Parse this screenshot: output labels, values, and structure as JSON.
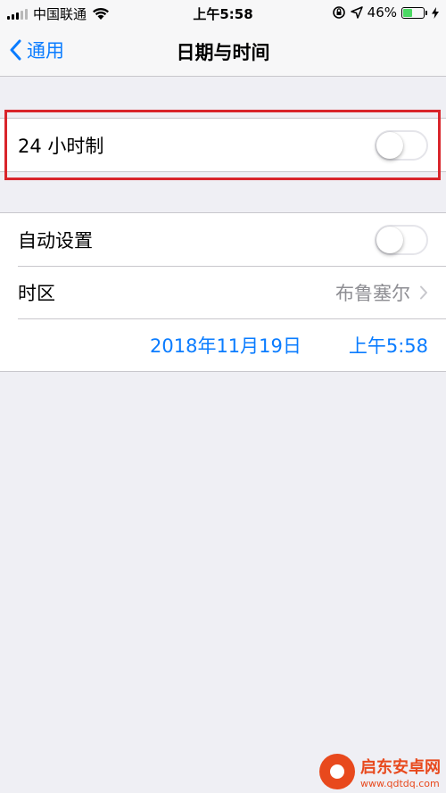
{
  "status_bar": {
    "carrier": "中国联通",
    "time": "上午5:58",
    "battery_percent": "46%",
    "battery_level": 0.46,
    "icons": [
      "signal-icon",
      "wifi-icon",
      "orientation-lock-icon",
      "location-icon",
      "battery-icon",
      "charging-icon"
    ]
  },
  "nav": {
    "back_label": "通用",
    "title": "日期与时间"
  },
  "settings": {
    "twenty_four_hour": {
      "label": "24 小时制",
      "enabled": false
    },
    "auto_set": {
      "label": "自动设置",
      "enabled": false
    },
    "timezone": {
      "label": "时区",
      "value": "布鲁塞尔"
    },
    "datetime": {
      "date": "2018年11月19日",
      "time": "上午5:58"
    }
  },
  "watermark": {
    "name": "启东安卓网",
    "url": "www.qdtdq.com"
  },
  "colors": {
    "accent": "#0a7cff",
    "highlight": "#d9252b",
    "battery": "#4cd964",
    "background": "#efeff4"
  }
}
